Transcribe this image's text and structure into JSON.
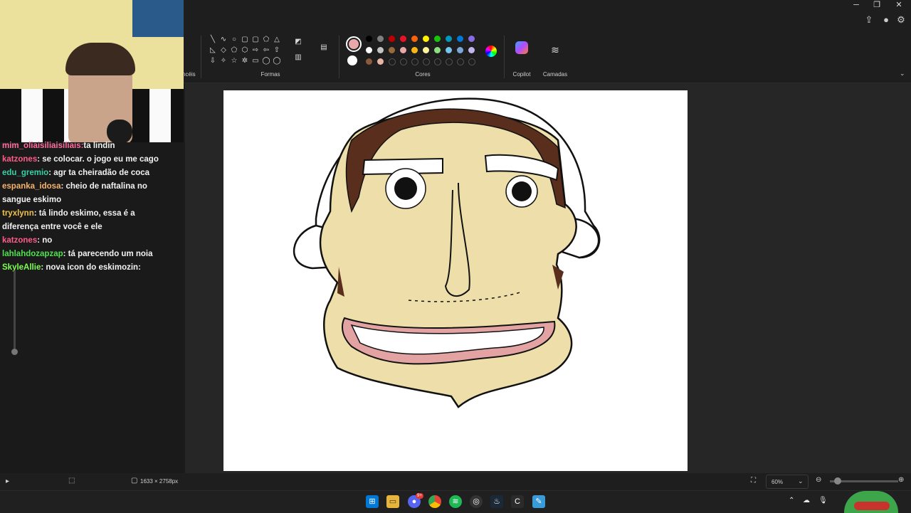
{
  "window": {
    "minimize_glyph": "─",
    "restore_glyph": "❐",
    "close_glyph": "✕"
  },
  "ribbon": {
    "groups": {
      "brushes_label": "ncéis",
      "shapes_label": "Formas",
      "colors_label": "Cores",
      "copilot_label": "Copilot",
      "layers_label": "Camadas"
    },
    "shapes": [
      "╲",
      "∿",
      "○",
      "▢",
      "▢",
      "⬠",
      "△",
      "◺",
      "◇",
      "⬠",
      "⬡",
      "⇨",
      "⇦",
      "⇧",
      "⇩",
      "✧",
      "☆",
      "✲",
      "▭",
      "◯",
      "◯"
    ],
    "palette": {
      "primary_color": "#e8a8a8",
      "secondary_color": "#ffffff",
      "row1": [
        "#000000",
        "#7f7f7f",
        "#c00000",
        "#e81224",
        "#f7630c",
        "#fff100",
        "#16c60c",
        "#0099bc",
        "#0078d7",
        "#886ce4",
        "#b146c2"
      ],
      "row2": [
        "#ffffff",
        "#c3c3c3",
        "#9a6a3f",
        "#e8a8a8",
        "#fcb714",
        "#fff59d",
        "#8be07d",
        "#75c6ee",
        "#7aa8d8",
        "#c3b6ee"
      ],
      "row3": [
        "#8a5a3a",
        "#e8b4a4"
      ]
    }
  },
  "chat": {
    "messages": [
      {
        "user": "mim_oliaisiliaisiliais:",
        "text": "ta lindin",
        "color": "#ff6fa0"
      },
      {
        "user": "katzones",
        "text": ": se colocar. o jogo eu me cago",
        "color": "#ff5c8a"
      },
      {
        "user": "edu_gremio",
        "text": ": agr ta cheiradão de coca",
        "color": "#36d1a6"
      },
      {
        "user": "espanka_idosa",
        "text": ": cheio de naftalina no",
        "color": "#f7b36b"
      },
      {
        "user": "",
        "text": "sangue eskimo",
        "color": "#f2f2f2"
      },
      {
        "user": "tryxlynn",
        "text": ": tá lindo eskimo, essa é a",
        "color": "#f0c34a"
      },
      {
        "user": "",
        "text": "diferença entre você e ele",
        "color": "#f2f2f2"
      },
      {
        "user": "katzones",
        "text": ": no",
        "color": "#ff5c8a"
      },
      {
        "user": "lahlahdozapzap",
        "text": ": tá parecendo um noia",
        "color": "#4fe04f"
      },
      {
        "user": "SkyleAllie",
        "text": ": nova icon do eskimozin:",
        "color": "#7cff4f"
      }
    ]
  },
  "status": {
    "canvas_size": "1633 × 2758px",
    "zoom": "60%"
  },
  "taskbar": {
    "discord_badge": "9+"
  }
}
